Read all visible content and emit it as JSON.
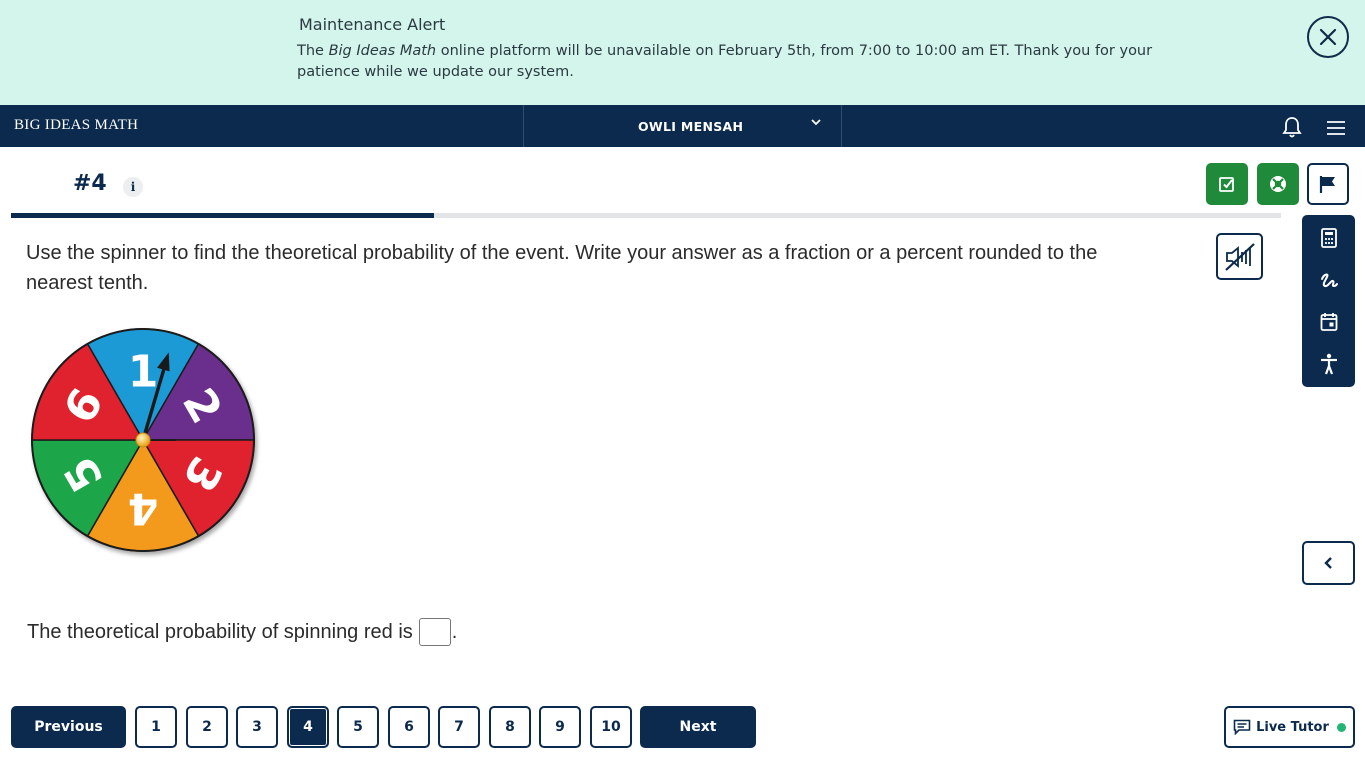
{
  "alert": {
    "title": "Maintenance Alert",
    "body_before": "The ",
    "body_italic": "Big Ideas Math",
    "body_after": " online platform will be unavailable on February 5th, from 7:00 to 10:00 am ET. Thank you for your patience while we update our system."
  },
  "nav": {
    "brand": "BIG IDEAS MATH",
    "user": "OWLI MENSAH"
  },
  "question": {
    "number": "#4",
    "info": "i",
    "progress": 0.4,
    "text": "Use the spinner to find the theoretical probability of the event. Write your answer as a fraction or a percent rounded to the nearest tenth.",
    "answer_prefix": "The theoretical probability of spinning red is",
    "answer_suffix": ".",
    "answer_value": ""
  },
  "spinner": {
    "sections": [
      {
        "label": "1",
        "color": "#1e9ad6"
      },
      {
        "label": "2",
        "color": "#6b2f8c"
      },
      {
        "label": "3",
        "color": "#e0202e"
      },
      {
        "label": "4",
        "color": "#f39a1f"
      },
      {
        "label": "5",
        "color": "#1ea64a"
      },
      {
        "label": "6",
        "color": "#e0202e"
      }
    ]
  },
  "pagination": {
    "previous": "Previous",
    "next": "Next",
    "pages": [
      "1",
      "2",
      "3",
      "4",
      "5",
      "6",
      "7",
      "8",
      "9",
      "10"
    ],
    "current": "4"
  },
  "live_tutor": "Live Tutor",
  "colors": {
    "navy": "#0b2a4d",
    "green": "#1f8a3a",
    "alert_bg": "#d4f5ec",
    "online_dot": "#22b573"
  },
  "icons": {
    "check": "check-square-icon",
    "help": "lifebuoy-icon",
    "flag": "flag-icon",
    "calculator": "calculator-icon",
    "scribble": "scribble-icon",
    "calendar": "calendar-icon",
    "accessibility": "accessibility-icon",
    "audio": "audio-muted-icon"
  }
}
